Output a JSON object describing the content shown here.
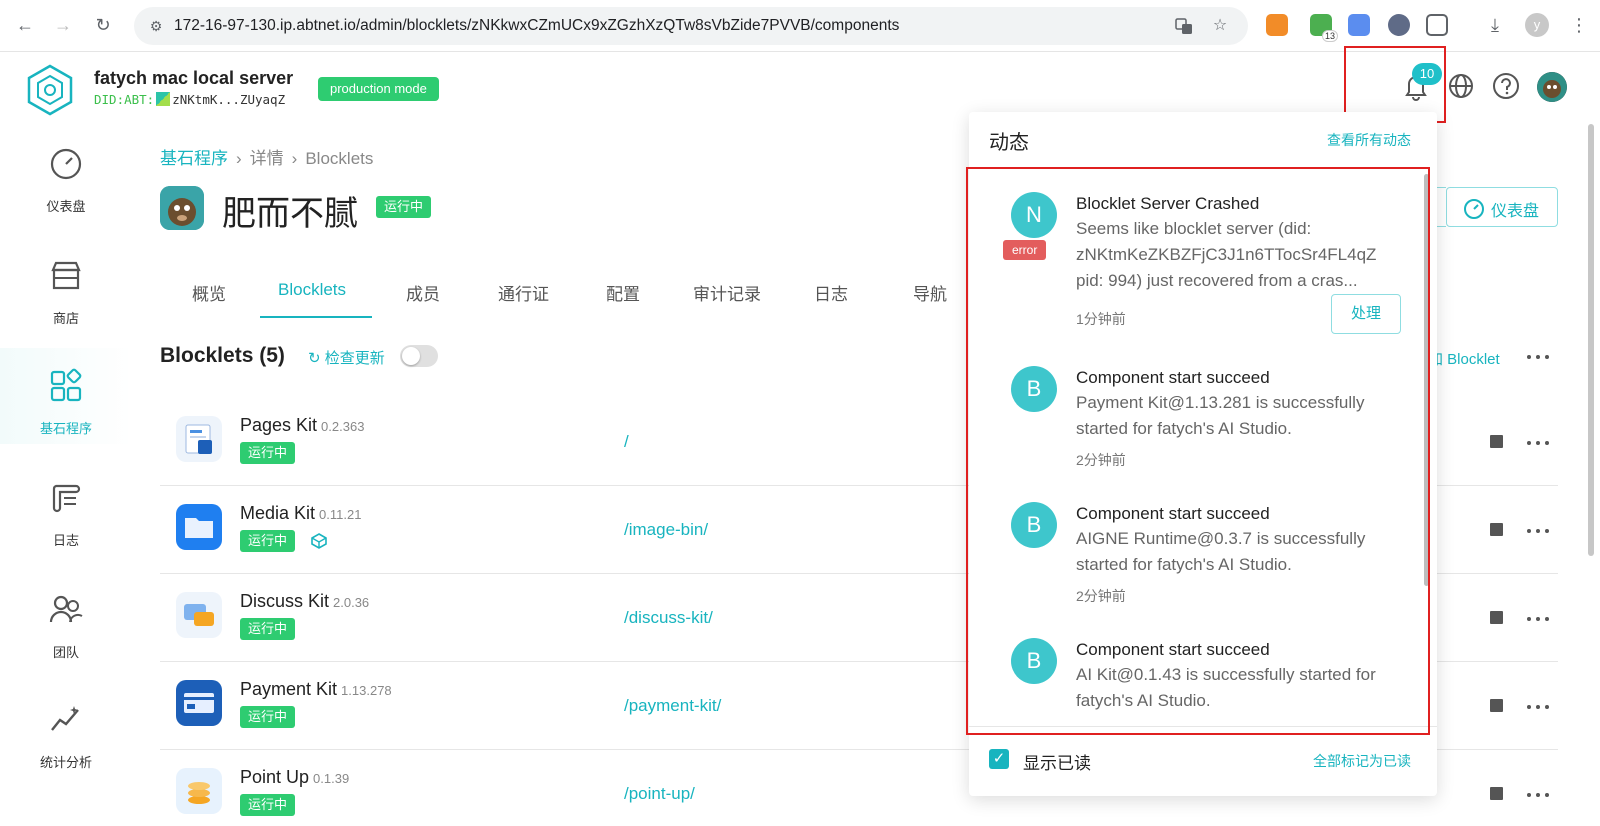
{
  "browser": {
    "url": "172-16-97-130.ip.abtnet.io/admin/blocklets/zNKkwxCZmUCx9xZGzhXzQTw8sVbZide7PVVB/components",
    "extension_badge": "13",
    "profile_initial": "y"
  },
  "header": {
    "server_name": "fatych mac local server",
    "did_prefix": "DID:ABT:",
    "did_short": "zNKtmK...ZUyaqZ",
    "mode_badge": "production mode",
    "notification_count": "10"
  },
  "sidebar": {
    "items": [
      {
        "label": "仪表盘",
        "icon": "dashboard-icon"
      },
      {
        "label": "商店",
        "icon": "store-icon"
      },
      {
        "label": "基石程序",
        "icon": "blocklets-icon",
        "active": true
      },
      {
        "label": "日志",
        "icon": "log-icon"
      },
      {
        "label": "团队",
        "icon": "team-icon"
      },
      {
        "label": "统计分析",
        "icon": "analytics-icon"
      }
    ]
  },
  "breadcrumb": {
    "root": "基石程序",
    "detail": "详情",
    "current": "Blocklets"
  },
  "app": {
    "title": "肥而不腻",
    "status": "运行中"
  },
  "tabs": [
    "概览",
    "Blocklets",
    "成员",
    "通行证",
    "配置",
    "审计记录",
    "日志",
    "导航"
  ],
  "actions": {
    "dashboard": "仪表盘",
    "add_blocklet": "加 Blocklet"
  },
  "section": {
    "title": "Blocklets (5)",
    "check_update": "检查更新"
  },
  "blocklets": [
    {
      "name": "Pages Kit",
      "version": "0.2.363",
      "status": "运行中",
      "path": "/"
    },
    {
      "name": "Media Kit",
      "version": "0.11.21",
      "status": "运行中",
      "path": "/image-bin/"
    },
    {
      "name": "Discuss Kit",
      "version": "2.0.36",
      "status": "运行中",
      "path": "/discuss-kit/"
    },
    {
      "name": "Payment Kit",
      "version": "1.13.278",
      "status": "运行中",
      "path": "/payment-kit/"
    },
    {
      "name": "Point Up",
      "version": "0.1.39",
      "status": "运行中",
      "path": "/point-up/"
    }
  ],
  "notifications": {
    "title": "动态",
    "view_all": "查看所有动态",
    "items": [
      {
        "avatar": "N",
        "tag": "error",
        "title": "Blocklet Server Crashed",
        "body": "Seems like blocklet server (did: zNKtmKeZKBZFjC3J1n6TTocSr4FL4qZ pid: 994) just recovered from a cras...",
        "time": "1分钟前",
        "action": "处理"
      },
      {
        "avatar": "B",
        "title": "Component start succeed",
        "body": "Payment Kit@1.13.281 is successfully started for fatych's AI Studio.",
        "time": "2分钟前"
      },
      {
        "avatar": "B",
        "title": "Component start succeed",
        "body": "AIGNE Runtime@0.3.7 is successfully started for fatych's AI Studio.",
        "time": "2分钟前"
      },
      {
        "avatar": "B",
        "title": "Component start succeed",
        "body": "AI Kit@0.1.43 is successfully started for fatych's AI Studio.",
        "time": ""
      }
    ],
    "show_read": "显示已读",
    "mark_all_read": "全部标记为已读"
  }
}
